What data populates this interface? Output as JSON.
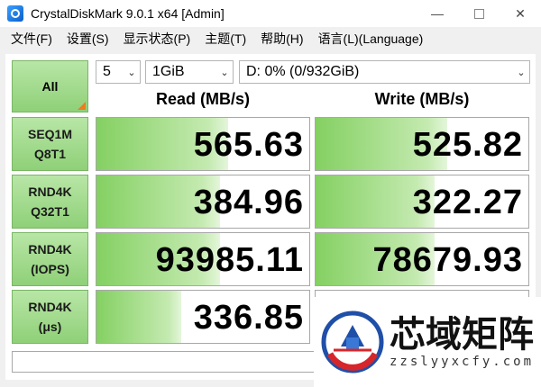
{
  "window": {
    "title": "CrystalDiskMark 9.0.1 x64 [Admin]",
    "controls": [
      "—",
      "✕"
    ]
  },
  "menu": [
    "文件(F)",
    "设置(S)",
    "显示状态(P)",
    "主题(T)",
    "帮助(H)",
    "语言(L)(Language)"
  ],
  "controls": {
    "all_label": "All",
    "count": "5",
    "size": "1GiB",
    "drive": "D: 0% (0/932GiB)"
  },
  "headers": {
    "read": "Read (MB/s)",
    "write": "Write (MB/s)"
  },
  "tests": [
    {
      "line1": "SEQ1M",
      "line2": "Q8T1",
      "read": "565.63",
      "write": "525.82",
      "read_fill": 0.62,
      "write_fill": 0.62
    },
    {
      "line1": "RND4K",
      "line2": "Q32T1",
      "read": "384.96",
      "write": "322.27",
      "read_fill": 0.58,
      "write_fill": 0.56
    },
    {
      "line1": "RND4K",
      "line2": "(IOPS)",
      "read": "93985.11",
      "write": "78679.93",
      "read_fill": 0.58,
      "write_fill": 0.56
    },
    {
      "line1": "RND4K",
      "line2": "(μs)",
      "read": "336.85",
      "write": "",
      "read_fill": 0.4,
      "write_fill": 0.0
    }
  ],
  "status_text": "",
  "watermark": {
    "title": "芯域矩阵",
    "subtitle": "zzslyyxcfy.com"
  },
  "colors": {
    "label_green": "#8fd078",
    "bar_green": "#84d062",
    "accent_orange": "#f07b1e"
  }
}
